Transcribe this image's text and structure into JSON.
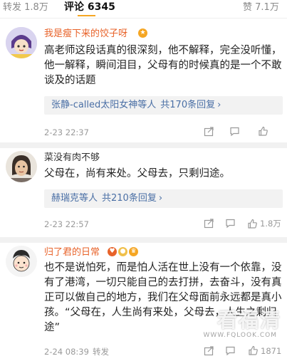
{
  "tabs": {
    "repost_label": "转发",
    "repost_count": "1.8万",
    "comments_label": "评论",
    "comments_count": "6345",
    "likes_label": "赞",
    "likes_count": "7.1万"
  },
  "comments": [
    {
      "username": "我是瘦下来的饺子呀",
      "text": "高老师这段话真的很深刻，他不解释，完全没听懂，他一解释，瞬间泪目，父母有的时候真的是一个不敢谈及的话题",
      "reply_users": "张静-called太阳女神等人",
      "reply_count": "共170条回复",
      "time": "2-23 22:37",
      "likes": ""
    },
    {
      "username": "菜没有肉不够",
      "text": "父母在，尚有来处。父母去，只剩归途。",
      "reply_users": "赫瑞克等人",
      "reply_count": "共210条回复",
      "time": "2-23 22:57",
      "likes": "1.8万"
    },
    {
      "username": "归了君的日常",
      "text": "也不是说怕死，而是怕人活在世上没有一个依靠，没有了港湾，一切只能自己的去打拼，去奋斗，没有真正可以做自己的地方，我们在父母面前永远都是真小孩。“父母在，人生尚有来处，父母去，人生之剩归途”",
      "time": "2-24 08:39",
      "repost_label": "转发",
      "likes": "1871"
    }
  ],
  "watermark": {
    "text": "看福清",
    "sub": "WWW.FQLOOK.COM"
  },
  "colors": {
    "accent": "#f5a623",
    "vip_name": "#e8632a",
    "link": "#4a6fa5",
    "separator": "#f1f1f1"
  }
}
